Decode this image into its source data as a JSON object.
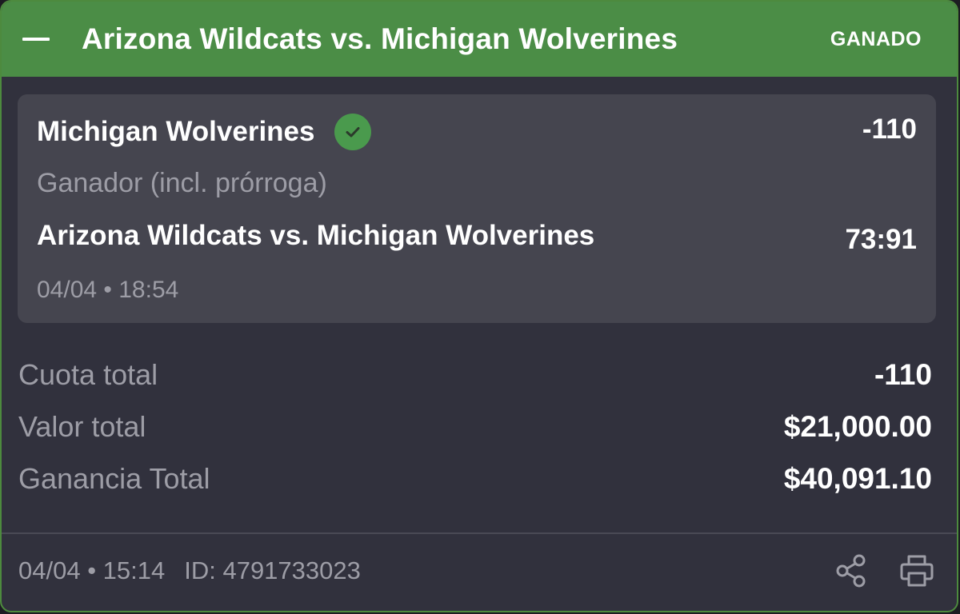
{
  "header": {
    "title": "Arizona Wildcats vs. Michigan Wolverines",
    "status": "GANADO",
    "collapse_icon": "minus-icon"
  },
  "selection": {
    "team": "Michigan Wolverines",
    "team_status_icon": "check-circle-icon",
    "odds": "-110",
    "market": "Ganador (incl. prórroga)",
    "event": "Arizona Wildcats vs. Michigan Wolverines",
    "score": "73:91",
    "datetime": "04/04 • 18:54"
  },
  "summary": {
    "total_odds_label": "Cuota total",
    "total_odds_value": "-110",
    "total_stake_label": "Valor total",
    "total_stake_value": "$21,000.00",
    "total_win_label": "Ganancia Total",
    "total_win_value": "$40,091.10"
  },
  "footer": {
    "datetime": "04/04 • 15:14",
    "id_text": "ID: 4791733023",
    "share_icon": "share-icon",
    "print_icon": "print-icon"
  },
  "colors": {
    "header_green": "#4b8d46",
    "card_background": "#31313d",
    "selection_background": "#45454f",
    "check_green": "#4a9a4d",
    "muted_text": "#9d9da6"
  }
}
